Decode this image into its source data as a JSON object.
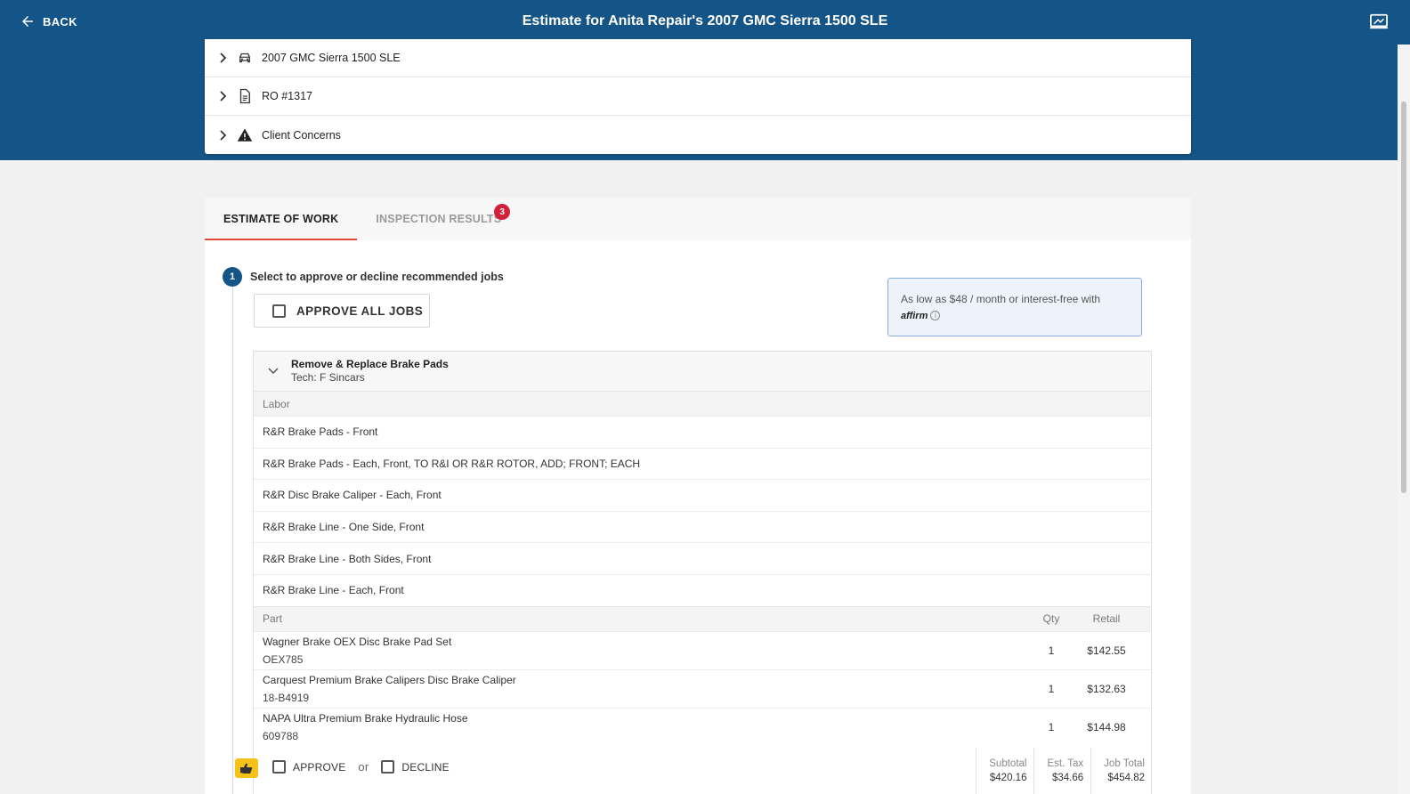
{
  "header": {
    "back_label": "BACK",
    "title": "Estimate for Anita Repair's 2007 GMC Sierra 1500 SLE"
  },
  "summary": {
    "items": [
      {
        "label": "2007 GMC Sierra 1500 SLE",
        "icon": "car-icon"
      },
      {
        "label": "RO #1317",
        "icon": "document-icon"
      },
      {
        "label": "Client Concerns",
        "icon": "warning-icon"
      }
    ]
  },
  "tabs": [
    {
      "label": "ESTIMATE OF WORK",
      "active": true
    },
    {
      "label": "INSPECTION RESULTS",
      "badge": "3"
    }
  ],
  "step": {
    "number": "1",
    "text": "Select to approve or decline recommended jobs"
  },
  "approve_all_label": "APPROVE ALL JOBS",
  "affirm": {
    "text": "As low as $48 / month or interest-free with",
    "logo": "affirm"
  },
  "job": {
    "title": "Remove & Replace Brake Pads",
    "tech": "Tech: F Sincars",
    "labor_header": "Labor",
    "labor": [
      "R&R Brake Pads - Front",
      "R&R Brake Pads - Each, Front, TO R&I OR R&R ROTOR, ADD; FRONT; EACH",
      "R&R Disc Brake Caliper - Each, Front",
      "R&R Brake Line - One Side, Front",
      "R&R Brake Line - Both Sides, Front",
      "R&R Brake Line - Each, Front"
    ],
    "parts_header": {
      "part": "Part",
      "qty": "Qty",
      "retail": "Retail"
    },
    "parts": [
      {
        "name": "Wagner Brake OEX Disc Brake Pad Set",
        "number": "OEX785",
        "qty": "1",
        "retail": "$142.55"
      },
      {
        "name": "Carquest Premium Brake Calipers Disc Brake Caliper",
        "number": "18-B4919",
        "qty": "1",
        "retail": "$132.63"
      },
      {
        "name": "NAPA Ultra Premium Brake Hydraulic Hose",
        "number": "609788",
        "qty": "1",
        "retail": "$144.98"
      }
    ]
  },
  "footer": {
    "approve_label": "APPROVE",
    "or_label": "or",
    "decline_label": "DECLINE",
    "subtotal_label": "Subtotal",
    "subtotal": "$420.16",
    "tax_label": "Est. Tax",
    "tax": "$34.66",
    "total_label": "Job Total",
    "total": "$454.82"
  },
  "colors": {
    "primary": "#155486",
    "accent": "#e04b3a",
    "badge": "#d3203a",
    "hand": "#f6c21a"
  }
}
